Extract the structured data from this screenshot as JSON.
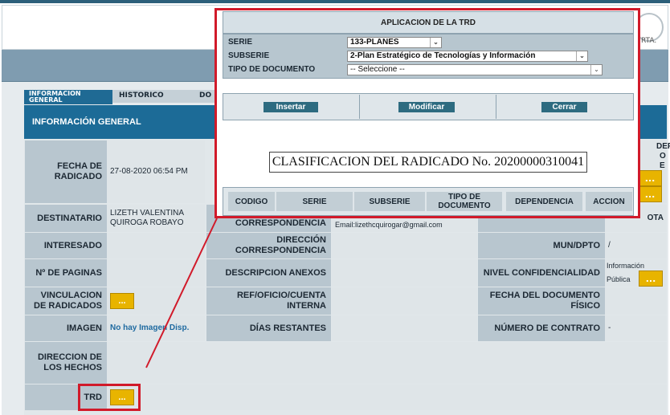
{
  "header": {
    "logo_text": "Q.RTA."
  },
  "tabs": [
    {
      "label": "INFORMACION GENERAL"
    },
    {
      "label": "HISTORICO"
    },
    {
      "label": "DO"
    }
  ],
  "section_title": "INFORMACIÓN GENERAL",
  "fields": {
    "fecha_radicado": {
      "label": "FECHA DE RADICADO",
      "value": "27-08-2020 06:54 PM"
    },
    "destinatario": {
      "label": "DESTINATARIO",
      "value": "LIZETH VALENTINA QUIROGA ROBAYO"
    },
    "correspondencia": {
      "label": "CORRESPONDENCIA",
      "value": "Email:lizethcquirogar@gmail.com"
    },
    "interesado": {
      "label": "INTERESADO"
    },
    "direccion_corresp": {
      "label": "DIRECCIÓN CORRESPONDENCIA"
    },
    "mun_dpto": {
      "label": "MUN/DPTO",
      "value": "/"
    },
    "num_paginas": {
      "label": "Nº DE PAGINAS"
    },
    "descripcion_anexos": {
      "label": "DESCRIPCION ANEXOS"
    },
    "nivel_conf": {
      "label": "NIVEL CONFIDENCIALIDAD",
      "value_line1": "Información",
      "value_line2": "Pública"
    },
    "vinculacion": {
      "label": "VINCULACION DE RADICADOS"
    },
    "ref_oficio": {
      "label": "REF/OFICIO/CUENTA INTERNA"
    },
    "fecha_doc_fisico": {
      "label": "FECHA DEL DOCUMENTO FÍSICO"
    },
    "imagen": {
      "label": "IMAGEN",
      "value": "No hay Imagen Disp."
    },
    "dias_restantes": {
      "label": "DÍAS RESTANTES"
    },
    "numero_contrato": {
      "label": "NÚMERO DE CONTRATO",
      "value": "-"
    },
    "direccion_hechos": {
      "label": "DIRECCION DE LOS HECHOS"
    },
    "trd": {
      "label": "TRD"
    }
  },
  "right_fragments": {
    "f1": "DER",
    "f2": "O",
    "f3": "E",
    "f4": "OTA"
  },
  "dots_label": "...",
  "modal": {
    "title": "APLICACION DE LA TRD",
    "serie_label": "SERIE",
    "serie_value": "133-PLANES",
    "subserie_label": "SUBSERIE",
    "subserie_value": "2-Plan Estratégico de Tecnologías y Información",
    "tipo_label": "TIPO DE DOCUMENTO",
    "tipo_value": "-- Seleccione --",
    "insert_label": "Insertar",
    "modify_label": "Modificar",
    "close_label": "Cerrar",
    "clasificacion": "CLASIFICACION DEL RADICADO No. 20200000310041",
    "columns": [
      "CODIGO",
      "SERIE",
      "SUBSERIE",
      "TIPO DE DOCUMENTO",
      "DEPENDENCIA",
      "ACCION"
    ]
  },
  "colors": {
    "accent": "#1c6b97",
    "button_yellow": "#e8b400",
    "highlight_red": "#d11a2a"
  }
}
